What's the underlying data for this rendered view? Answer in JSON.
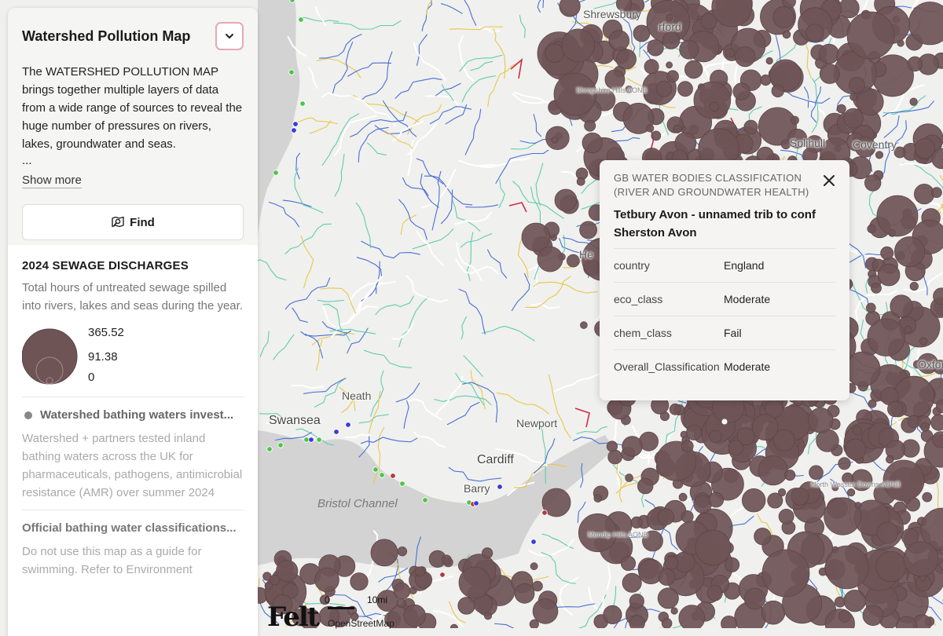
{
  "panel": {
    "title": "Watershed Pollution Map",
    "description": "The WATERSHED POLLUTION MAP brings together multiple layers of data from a wide range of sources to reveal the huge number of pressures on rivers, lakes, groundwater and seas.",
    "ellipsis": "...",
    "show_more": "Show more",
    "find_label": "Find",
    "icons": {
      "collapse": "chevron-down-icon",
      "find": "map-search-icon"
    },
    "sewage": {
      "title": "2024 SEWAGE DISCHARGES",
      "description": "Total hours of untreated sewage spilled into rivers, lakes and seas during the year.",
      "legend_values": [
        "365.52",
        "91.38",
        "0"
      ]
    },
    "bathing": {
      "title": "Watershed bathing waters invest...",
      "description": "Watershed + partners tested inland bathing waters across the UK for pharmaceuticals, pathogens, antimicrobial resistance (AMR) over summer 2024"
    },
    "official": {
      "title": "Official bathing water classifications...",
      "description": "Do not use this map as a guide for swimming. Refer to Environment"
    }
  },
  "popup": {
    "category": "GB WATER BODIES CLASSIFICATION (RIVER AND GROUNDWATER HEALTH)",
    "title": "Tetbury Avon - unnamed trib to conf Sherston Avon",
    "rows": [
      {
        "key": "country",
        "value": "England"
      },
      {
        "key": "eco_class",
        "value": "Moderate"
      },
      {
        "key": "chem_class",
        "value": "Fail"
      },
      {
        "key": "Overall_Classification",
        "value": "Moderate"
      }
    ]
  },
  "map": {
    "labels": [
      "Swansea",
      "Neath",
      "Newport",
      "Cardiff",
      "Barry",
      "Bristol Channel",
      "He",
      "Shropshire Hills AONB",
      "Mendip Hills AONB",
      "North Wessex Downs AONB",
      "Solihull",
      "Coventry",
      "rford",
      "Shrewsbury",
      "Oxford"
    ],
    "colors": {
      "sea": "#d3d3d3",
      "land": "#f0f0ee",
      "discharge": "#6f5456",
      "rivers": [
        "#4a6fd4",
        "#5fcdb0",
        "#e8c84a",
        "#ffffff",
        "#d12a45"
      ]
    }
  },
  "attribution": {
    "logo": "Felt",
    "scale_zero": "0",
    "scale_distance": "10mi",
    "osm": "OpenStreetMap"
  }
}
